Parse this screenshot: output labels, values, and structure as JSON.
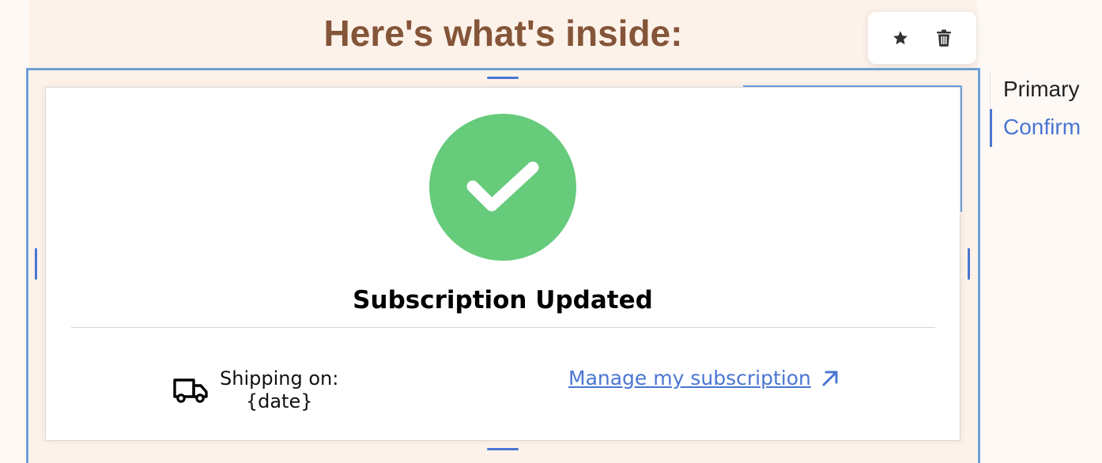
{
  "header": {
    "title": "Here's what's inside:"
  },
  "toolbar": {
    "items": [
      {
        "icon": "star-icon"
      },
      {
        "icon": "trash-icon"
      }
    ]
  },
  "card": {
    "status_icon": "checkmark-icon",
    "status_color": "#66cb7b",
    "status_title": "Subscription Updated",
    "shipping": {
      "icon": "truck-icon",
      "label": "Shipping on:",
      "value": "{date}"
    },
    "manage_link": {
      "label": "Manage my subscription",
      "icon": "arrow-up-right-icon"
    }
  },
  "side_nav": {
    "items": [
      {
        "label": "Primary",
        "active": false
      },
      {
        "label": "Confirm",
        "active": true
      }
    ]
  },
  "colors": {
    "accent": "#4a76d2",
    "heading": "#845538",
    "page_bg": "#fcf2ea",
    "selection": "#6c9fd6"
  }
}
